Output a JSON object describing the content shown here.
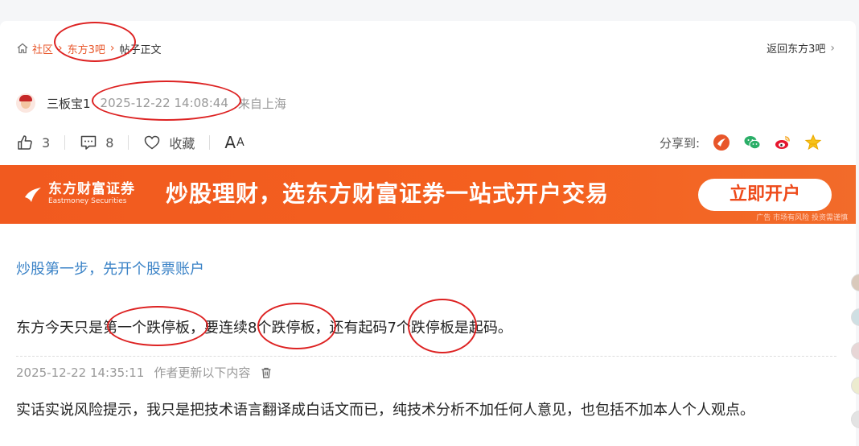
{
  "breadcrumb": {
    "items": [
      "社区",
      "东方3吧",
      "帖子正文"
    ],
    "back_label": "返回东方3吧"
  },
  "author": {
    "name": "三板宝1",
    "time": "2025-12-22 14:08:44",
    "from": "来自上海"
  },
  "actions": {
    "like_count": "3",
    "comment_count": "8",
    "collect_label": "收藏",
    "font_label_big": "A",
    "font_label_small": "A",
    "share_label": "分享到:"
  },
  "banner": {
    "brand_cn": "东方财富证券",
    "brand_en": "Eastmoney Securities",
    "slogan": "炒股理财，选东方财富证券一站式开户交易",
    "cta": "立即开户",
    "ad_note": "广告 市场有风险 投资需谨慎"
  },
  "post": {
    "promo_link": "炒股第一步，先开个股票账户",
    "paragraph1": "东方今天只是第一个跌停板，要连续8个跌停板，还有起码7个跌停板是起码。",
    "update_time": "2025-12-22 14:35:11",
    "update_note": "作者更新以下内容",
    "paragraph2": "实话实说风险提示，我只是把技术语言翻译成白话文而已，纯技术分析不加任何人意见，也包括不加本人个人观点。"
  },
  "colors": {
    "accent": "#e8562a",
    "banner": "#f15a1f",
    "link": "#3b83c7",
    "annotation": "#dd2222"
  }
}
